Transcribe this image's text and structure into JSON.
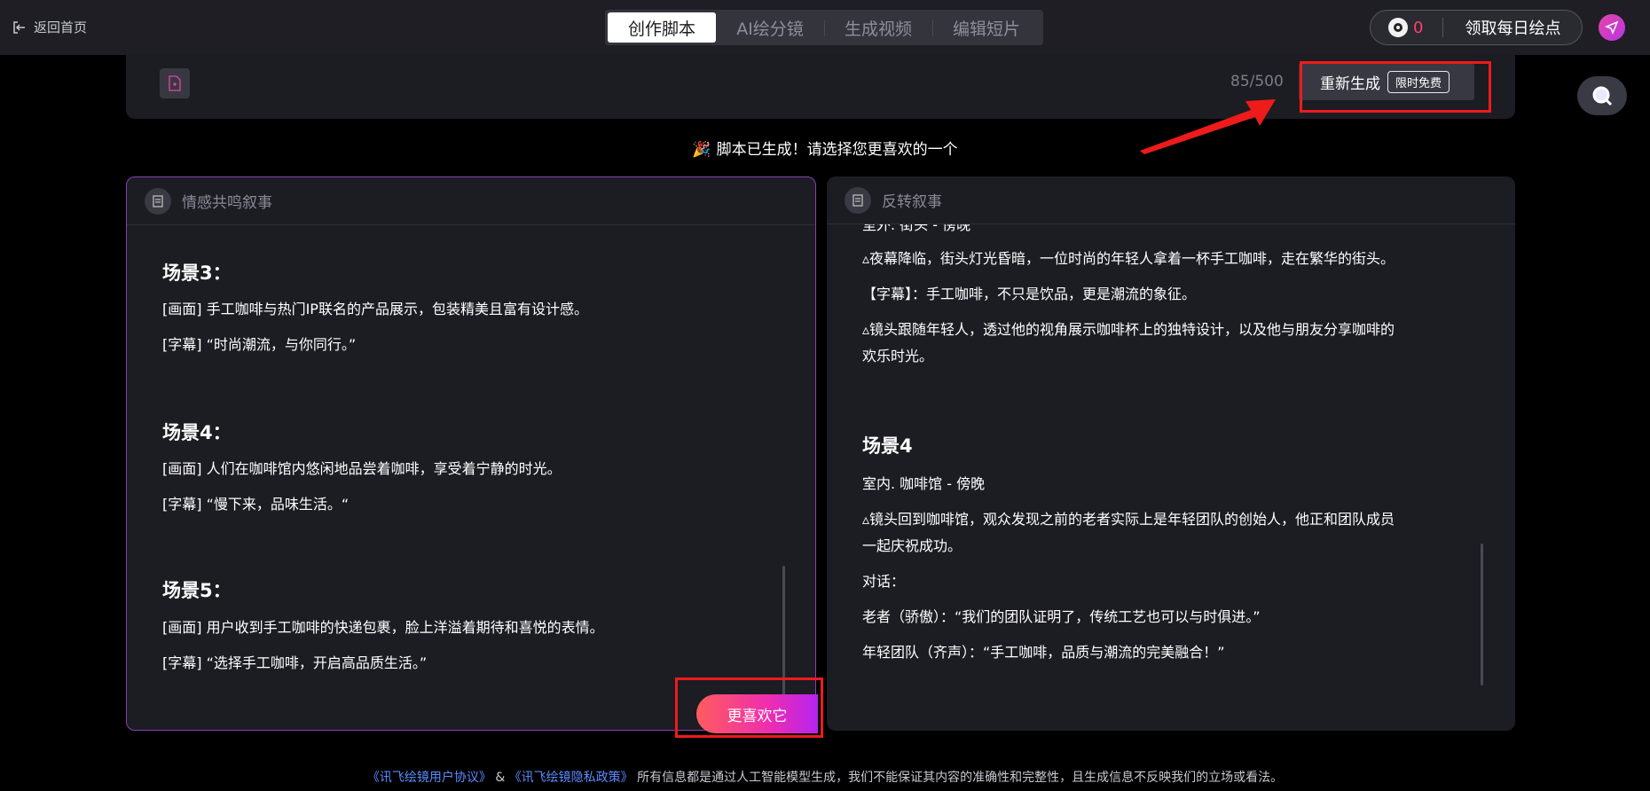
{
  "topbar": {
    "back_label": "返回首页",
    "tabs": [
      "创作脚本",
      "AI绘分镜",
      "生成视频",
      "编辑短片"
    ],
    "points_count": "0",
    "claim_label": "领取每日绘点"
  },
  "input_panel": {
    "char_count": "85/500",
    "regen_label": "重新生成",
    "free_badge": "限时免费"
  },
  "notice": "脚本已生成！请选择您更喜欢的一个",
  "left_card": {
    "title": "情感共鸣叙事",
    "scenes": [
      {
        "heading": "场景3：",
        "lines": [
          "[画面] 手工咖啡与热门IP联名的产品展示，包装精美且富有设计感。",
          "[字幕] “时尚潮流，与你同行。”"
        ]
      },
      {
        "heading": "场景4：",
        "lines": [
          "[画面] 人们在咖啡馆内悠闲地品尝着咖啡，享受着宁静的时光。",
          "[字幕] “慢下来，品味生活。“"
        ]
      },
      {
        "heading": "场景5：",
        "lines": [
          "[画面] 用户收到手工咖啡的快递包裹，脸上洋溢着期待和喜悦的表情。",
          "[字幕] “选择手工咖啡，开启高品质生活。”"
        ]
      }
    ],
    "prefer_label": "更喜欢它"
  },
  "right_card": {
    "title": "反转叙事",
    "partial_line": "室外. 街头 - 傍晚",
    "lines_a": [
      "▵夜幕降临，街头灯光昏暗，一位时尚的年轻人拿着一杯手工咖啡，走在繁华的街头。",
      "【字幕】：手工咖啡，不只是饮品，更是潮流的象征。",
      "▵镜头跟随年轻人，透过他的视角展示咖啡杯上的独特设计，以及他与朋友分享咖啡的",
      "欢乐时光。"
    ],
    "scene4_heading": "场景4",
    "lines_b": [
      "室内. 咖啡馆 - 傍晚",
      "▵镜头回到咖啡馆，观众发现之前的老者实际上是年轻团队的创始人，他正和团队成员",
      "一起庆祝成功。",
      "对话：",
      "老者（骄傲）：“我们的团队证明了，传统工艺也可以与时俱进。”",
      "年轻团队（齐声）：“手工咖啡，品质与潮流的完美融合！”"
    ]
  },
  "footer": {
    "link1": "《讯飞绘镜用户协议》",
    "amp": "&",
    "link2": "《讯飞绘镜隐私政策》",
    "text": "所有信息都是通过人工智能模型生成，我们不能保证其内容的准确性和完整性，且生成信息不反映我们的立场或看法。"
  },
  "colors": {
    "accent": "#b624f0",
    "highlight_red": "#ee1b1b",
    "link": "#5a8cff",
    "points": "#ff3d6a"
  }
}
